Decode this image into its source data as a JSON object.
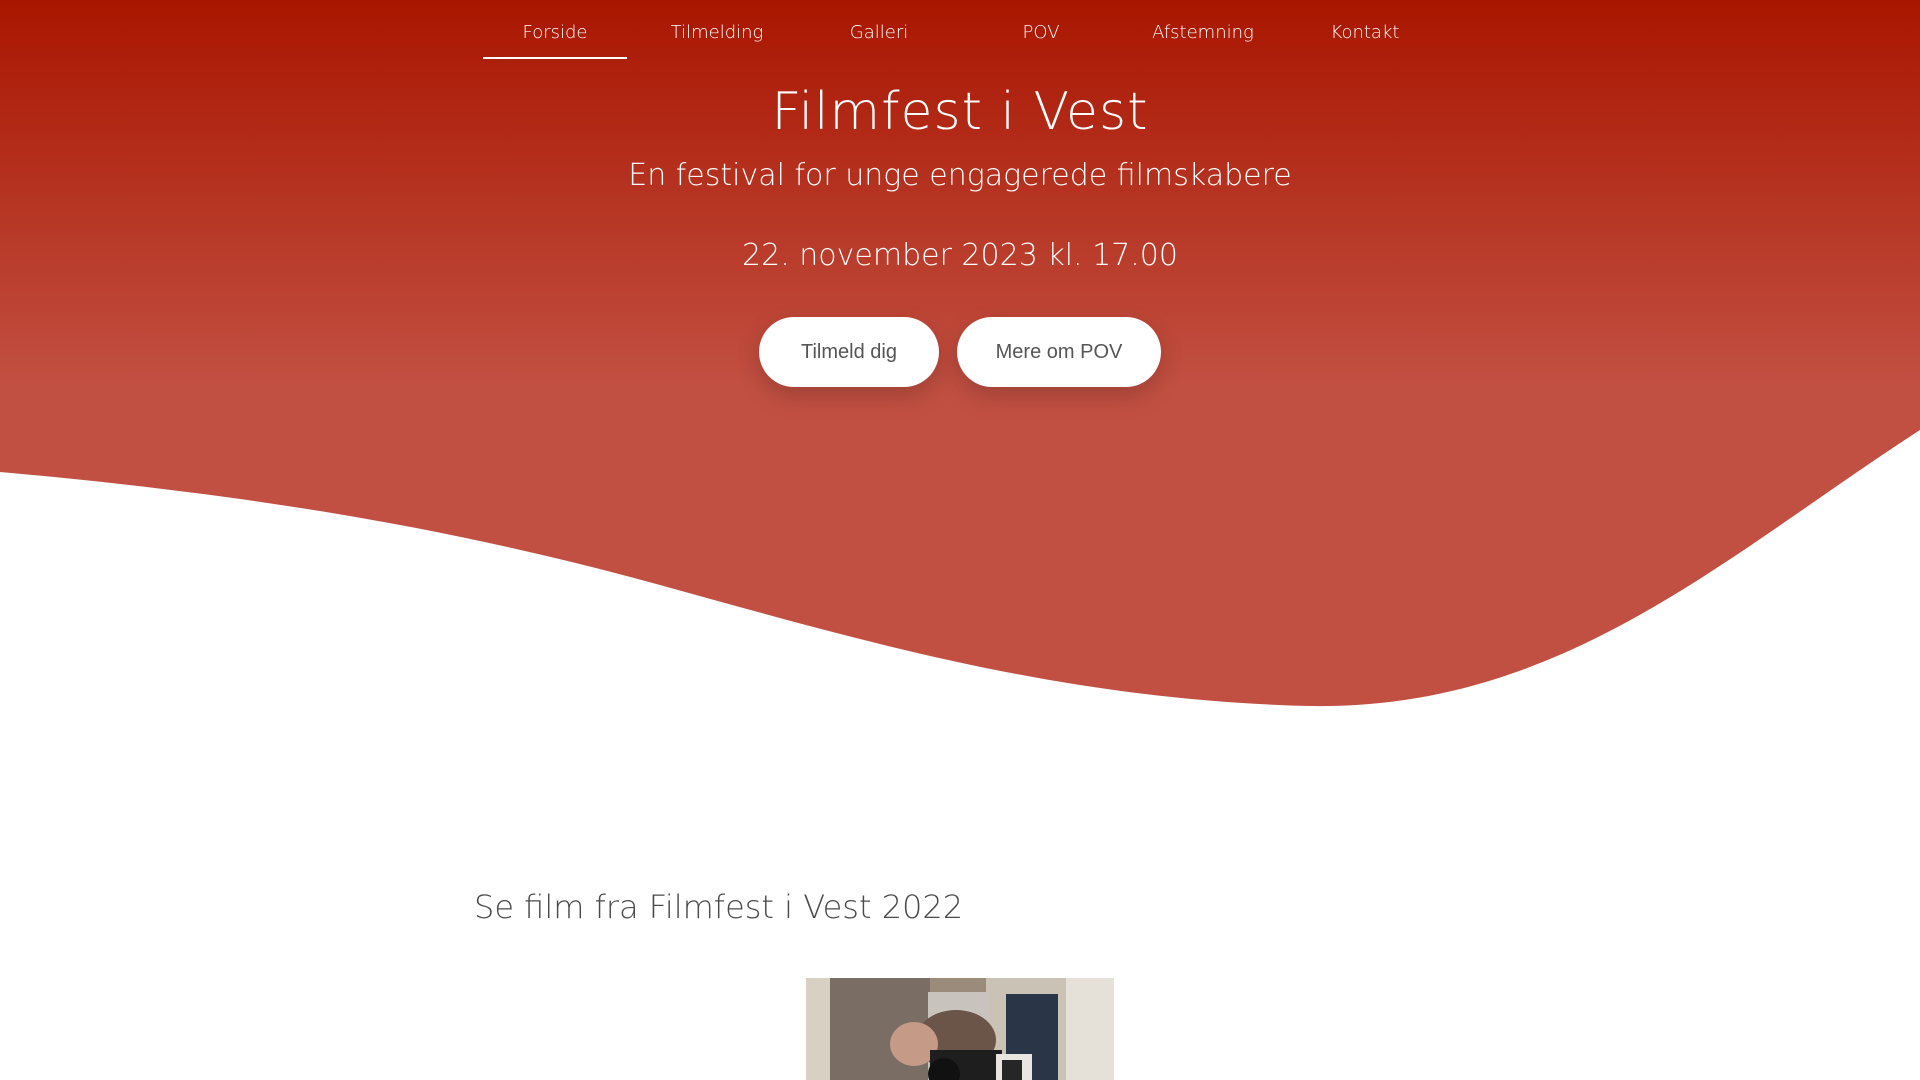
{
  "nav": {
    "items": [
      {
        "label": "Forside",
        "active": true
      },
      {
        "label": "Tilmelding",
        "active": false
      },
      {
        "label": "Galleri",
        "active": false
      },
      {
        "label": "POV",
        "active": false
      },
      {
        "label": "Afstemning",
        "active": false
      },
      {
        "label": "Kontakt",
        "active": false
      }
    ]
  },
  "hero": {
    "title": "Filmfest i Vest",
    "subtitle": "En festival for unge engagerede filmskabere",
    "date": "22. november 2023 kl. 17.00",
    "buttons": {
      "signup": "Tilmeld dig",
      "pov": "Mere om POV"
    }
  },
  "section": {
    "title": "Se film fra Filmfest i Vest 2022"
  },
  "colors": {
    "hero_top": "#a91600",
    "hero_bottom": "#c25042",
    "text_dark": "#4a4a4a",
    "button_bg": "#ffffff"
  },
  "icons": {
    "video_thumbnail": "photographer-with-camera-image"
  }
}
